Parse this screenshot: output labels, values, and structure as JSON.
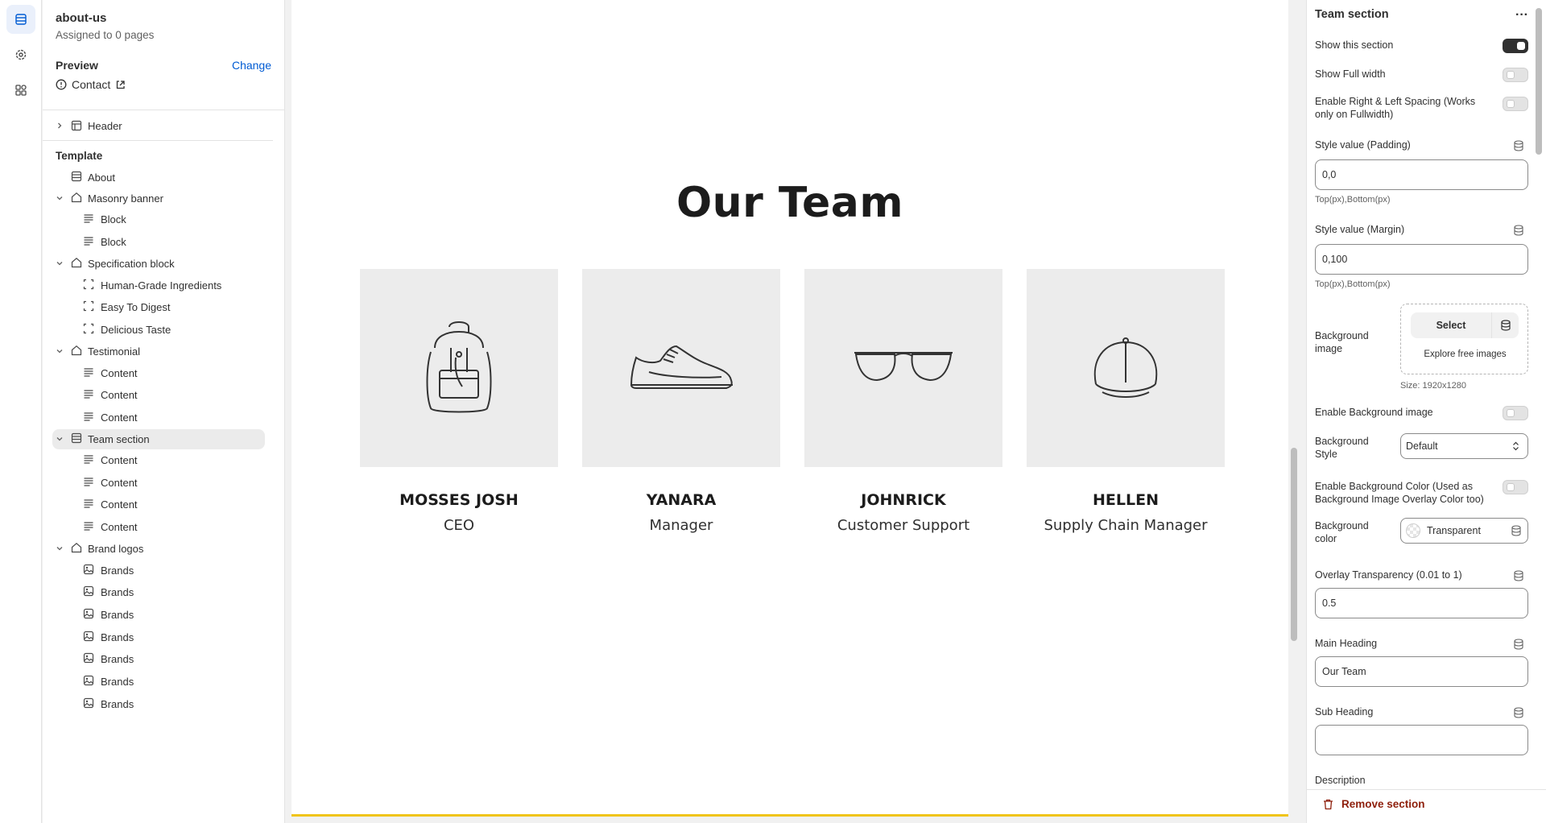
{
  "colors": {
    "accent": "#005bd3",
    "danger": "#8e1f0b",
    "toggle_on": "#303030",
    "canvas_border": "#f0c419"
  },
  "rail": {
    "items": [
      "sections-icon",
      "gear-icon",
      "apps-icon"
    ]
  },
  "sidebar": {
    "template_name": "about-us",
    "assigned": "Assigned to 0 pages",
    "preview_label": "Preview",
    "change_label": "Change",
    "preview_page": "Contact",
    "header_item": "Header",
    "template_title": "Template",
    "items": [
      {
        "label": "About",
        "level": 0,
        "icon": "section",
        "chevron": false
      },
      {
        "label": "Masonry banner",
        "level": 0,
        "icon": "home",
        "chevron": true
      },
      {
        "label": "Block",
        "level": 1,
        "icon": "text"
      },
      {
        "label": "Block",
        "level": 1,
        "icon": "text"
      },
      {
        "label": "Specification block",
        "level": 0,
        "icon": "home",
        "chevron": true
      },
      {
        "label": "Human-Grade Ingredients",
        "level": 1,
        "icon": "frame"
      },
      {
        "label": "Easy To Digest",
        "level": 1,
        "icon": "frame"
      },
      {
        "label": "Delicious Taste",
        "level": 1,
        "icon": "frame"
      },
      {
        "label": "Testimonial",
        "level": 0,
        "icon": "home",
        "chevron": true
      },
      {
        "label": "Content",
        "level": 1,
        "icon": "text"
      },
      {
        "label": "Content",
        "level": 1,
        "icon": "text"
      },
      {
        "label": "Content",
        "level": 1,
        "icon": "text"
      },
      {
        "label": "Team section",
        "level": 0,
        "icon": "section",
        "chevron": true,
        "selected": true
      },
      {
        "label": "Content",
        "level": 1,
        "icon": "text"
      },
      {
        "label": "Content",
        "level": 1,
        "icon": "text"
      },
      {
        "label": "Content",
        "level": 1,
        "icon": "text"
      },
      {
        "label": "Content",
        "level": 1,
        "icon": "text"
      },
      {
        "label": "Brand logos",
        "level": 0,
        "icon": "home",
        "chevron": true
      },
      {
        "label": "Brands",
        "level": 1,
        "icon": "image"
      },
      {
        "label": "Brands",
        "level": 1,
        "icon": "image"
      },
      {
        "label": "Brands",
        "level": 1,
        "icon": "image"
      },
      {
        "label": "Brands",
        "level": 1,
        "icon": "image"
      },
      {
        "label": "Brands",
        "level": 1,
        "icon": "image"
      },
      {
        "label": "Brands",
        "level": 1,
        "icon": "image"
      },
      {
        "label": "Brands",
        "level": 1,
        "icon": "image"
      }
    ]
  },
  "canvas": {
    "heading": "Our Team",
    "members": [
      {
        "name": "MOSSES JOSH",
        "role": "CEO",
        "image": "backpack"
      },
      {
        "name": "YANARA",
        "role": "Manager",
        "image": "sneaker"
      },
      {
        "name": "JOHNRICK",
        "role": "Customer Support",
        "image": "glasses"
      },
      {
        "name": "HELLEN",
        "role": "Supply Chain Manager",
        "image": "cap"
      }
    ]
  },
  "panel": {
    "title": "Team section",
    "more_label": "···",
    "show_section": "Show this section",
    "show_section_on": true,
    "full_width": "Show Full width",
    "full_width_on": false,
    "spacing": "Enable Right & Left Spacing (Works only on Fullwidth)",
    "spacing_on": false,
    "padding_label": "Style value (Padding)",
    "padding_value": "0,0",
    "padding_help": "Top(px),Bottom(px)",
    "margin_label": "Style value (Margin)",
    "margin_value": "0,100",
    "margin_help": "Top(px),Bottom(px)",
    "bg_image_label": "Background image",
    "select_label": "Select",
    "explore_label": "Explore free images",
    "size_label": "Size: 1920x1280",
    "enable_bg_image": "Enable Background image",
    "enable_bg_image_on": false,
    "bg_style_label": "Background Style",
    "bg_style_value": "Default",
    "enable_bg_color": "Enable Background Color (Used as Background Image Overlay Color too)",
    "enable_bg_color_on": false,
    "bg_color_label": "Background color",
    "bg_color_value": "Transparent",
    "overlay_label": "Overlay Transparency (0.01 to 1)",
    "overlay_value": "0.5",
    "main_heading_label": "Main Heading",
    "main_heading_value": "Our Team",
    "sub_heading_label": "Sub Heading",
    "sub_heading_value": "",
    "description_label": "Description",
    "remove_label": "Remove section"
  }
}
